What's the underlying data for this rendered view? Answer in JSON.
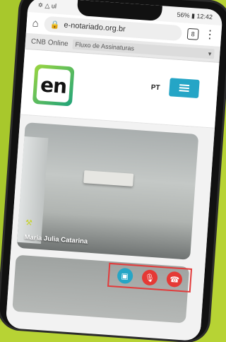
{
  "status": {
    "left": "✡ △ ul",
    "right": "56% ▮ 12:42"
  },
  "browser": {
    "url": "e-notariado.org.br",
    "tab_count": "8"
  },
  "cnb_bar": {
    "prefix": "CNB Online",
    "select": "Fluxo de Assinaturas"
  },
  "header": {
    "logo_text": "en",
    "lang": "PT"
  },
  "video": {
    "participant_name": "Maria Julia Catarina"
  },
  "colors": {
    "background": "#b7d334",
    "accent": "#25a5c6",
    "danger": "#e53935"
  }
}
